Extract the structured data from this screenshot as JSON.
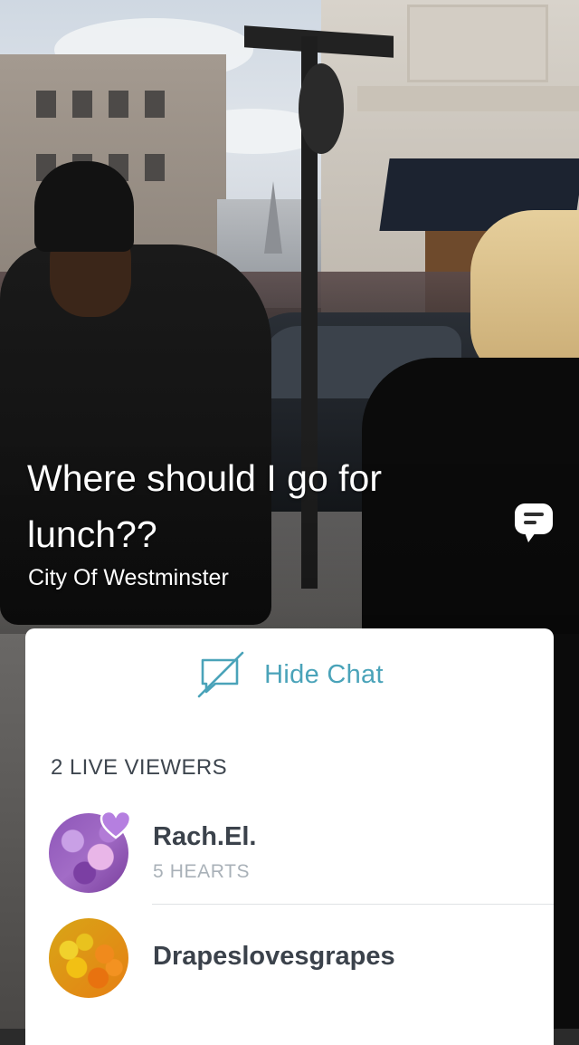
{
  "broadcast": {
    "title": "Where should I go for lunch??",
    "location": "City Of Westminster"
  },
  "colors": {
    "accent": "#4aa3b9",
    "heart": "#b57fe0",
    "panel_bg": "#ffffff",
    "text_dark": "#3b424b",
    "text_muted": "#a9b1b8"
  },
  "icons": {
    "chat_toggle": "chat-bubble-icon",
    "hide_chat": "chat-off-icon",
    "heart": "heart-icon"
  },
  "chat_panel": {
    "hide_chat_label": "Hide Chat",
    "viewers_label": "2 LIVE VIEWERS",
    "viewers": [
      {
        "name": "Rach.El.",
        "hearts": "5 HEARTS",
        "has_heart_badge": true
      },
      {
        "name": "Drapeslovesgrapes",
        "hearts": "",
        "has_heart_badge": false
      }
    ]
  }
}
